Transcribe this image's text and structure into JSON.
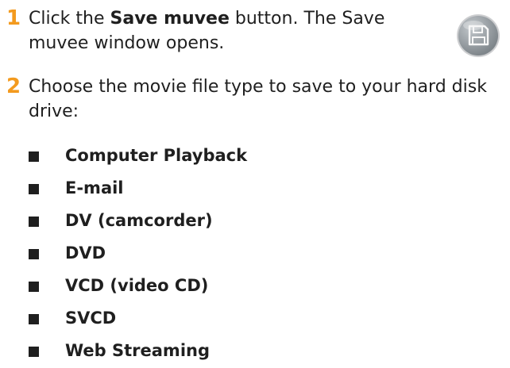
{
  "steps": [
    {
      "number": "1",
      "text_before": "Click the ",
      "bold": "Save muvee",
      "text_after": " button. The Save muvee window opens."
    },
    {
      "number": "2",
      "text": "Choose the movie file type to save to your hard disk drive:"
    }
  ],
  "save_button_icon": "floppy-disk-icon",
  "file_types": [
    "Computer Playback",
    "E-mail",
    "DV (camcorder)",
    "DVD",
    "VCD (video CD)",
    "SVCD",
    "Web Streaming"
  ],
  "colors": {
    "step_number": "#f39a1e",
    "text": "#1f1f1f",
    "icon_fill": "#8f959a"
  }
}
